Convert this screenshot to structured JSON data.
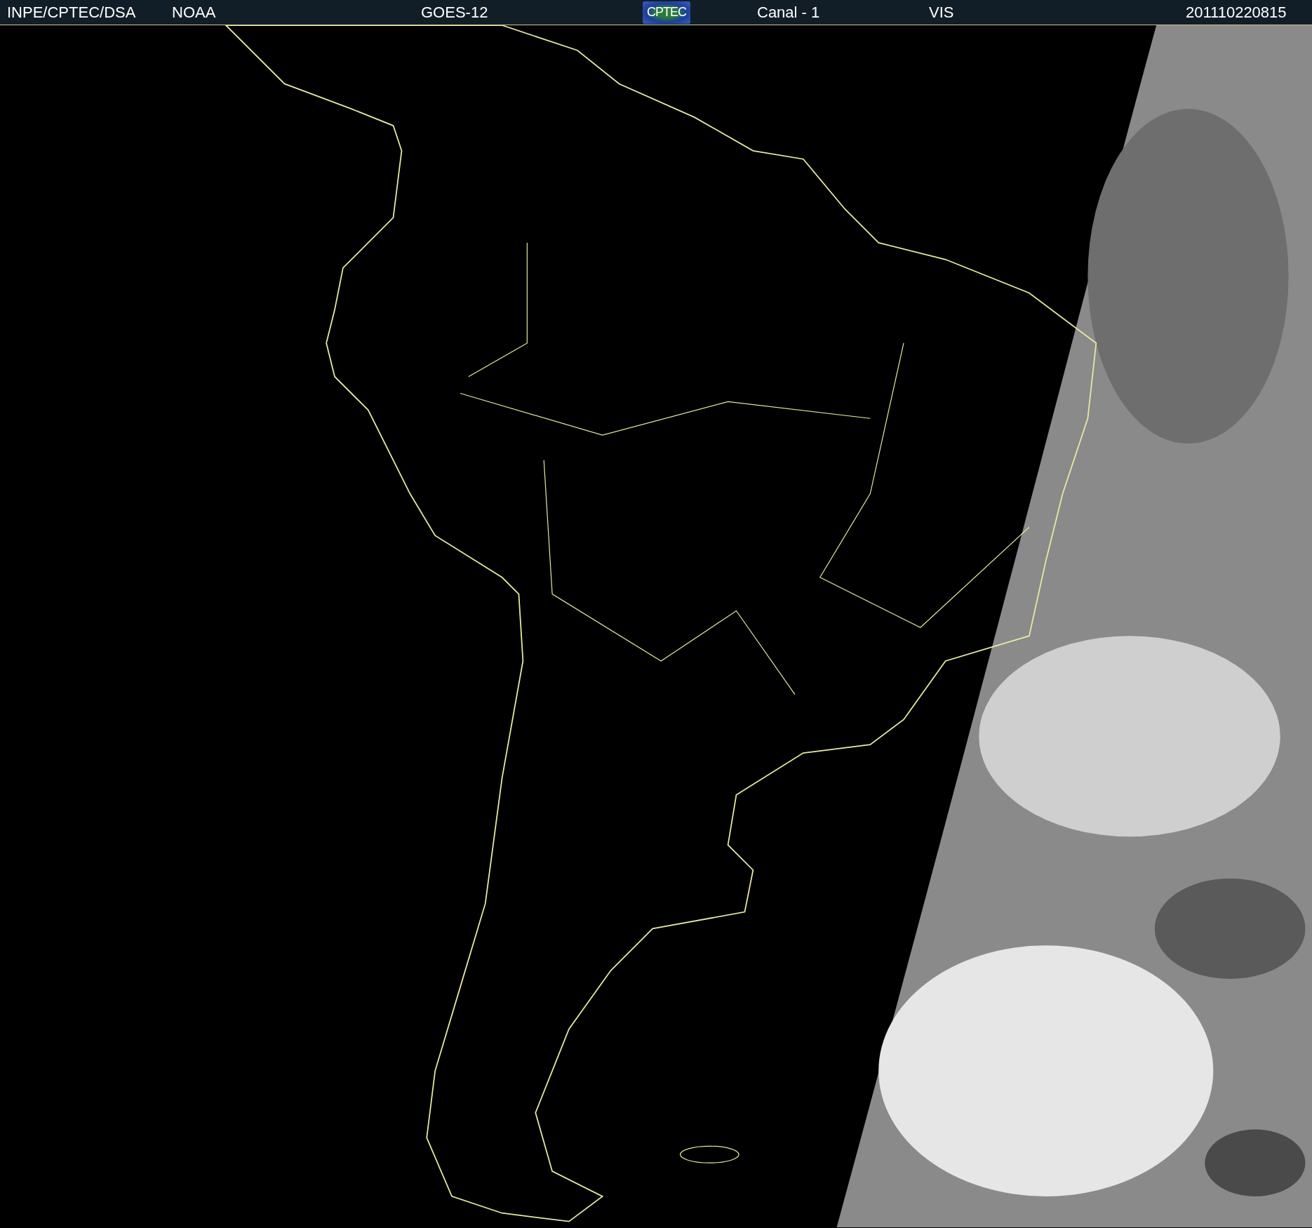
{
  "header": {
    "source": "INPE/CPTEC/DSA",
    "agency": "NOAA",
    "satellite": "GOES-12",
    "logo": "CPTEC",
    "channel": "Canal - 1",
    "band": "VIS",
    "timestamp": "201110220815"
  }
}
